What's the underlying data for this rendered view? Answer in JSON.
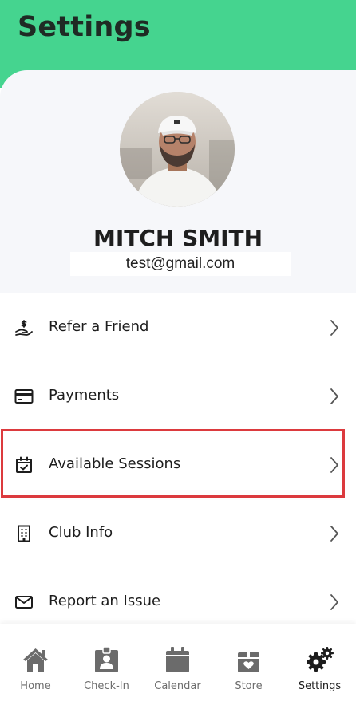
{
  "header": {
    "title": "Settings"
  },
  "profile": {
    "name": "MITCH SMITH",
    "email": "test@gmail.com"
  },
  "menu": [
    {
      "label": "Refer a Friend",
      "icon": "refer-friend-icon"
    },
    {
      "label": "Payments",
      "icon": "credit-card-icon"
    },
    {
      "label": "Available Sessions",
      "icon": "calendar-check-icon"
    },
    {
      "label": "Club Info",
      "icon": "building-icon"
    },
    {
      "label": "Report an Issue",
      "icon": "envelope-icon"
    }
  ],
  "tabs": [
    {
      "label": "Home",
      "icon": "home-icon"
    },
    {
      "label": "Check-In",
      "icon": "badge-icon"
    },
    {
      "label": "Calendar",
      "icon": "calendar-icon"
    },
    {
      "label": "Store",
      "icon": "gift-box-icon"
    },
    {
      "label": "Settings",
      "icon": "gears-icon",
      "active": true
    }
  ],
  "colors": {
    "accent": "#45d48f",
    "highlight": "#dc3a3e",
    "inactive_tab": "#6d6d6d"
  }
}
